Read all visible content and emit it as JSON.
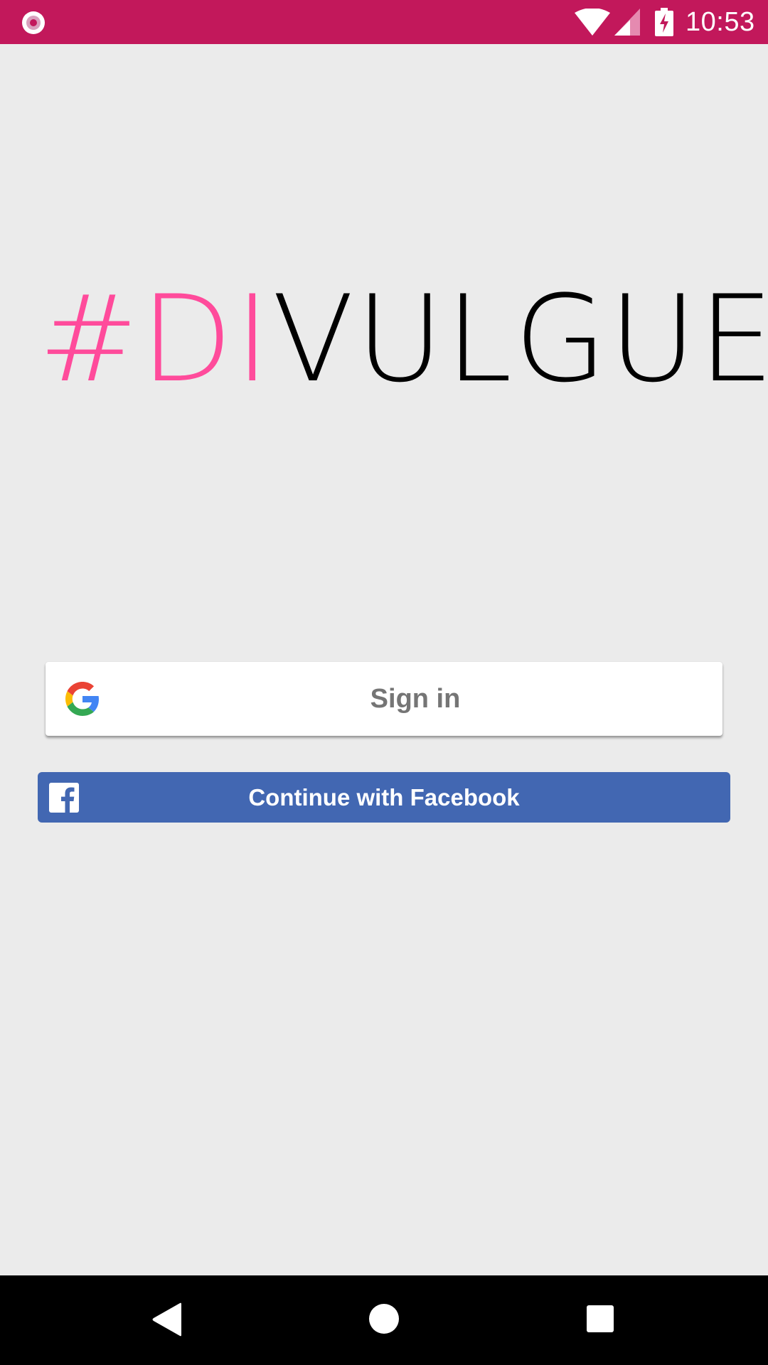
{
  "status_bar": {
    "time": "10:53",
    "background_color": "#c2185b",
    "icons": [
      "app-notification-icon",
      "wifi-icon",
      "cell-signal-icon",
      "battery-charging-icon"
    ]
  },
  "logo": {
    "part_accent": "#DI",
    "part_main": "VULGUE",
    "accent_color": "#ff4b9b",
    "main_color": "#000000"
  },
  "google_signin": {
    "label": "Sign in",
    "icon": "google-g-icon"
  },
  "facebook_login": {
    "label": "Continue with Facebook",
    "icon": "facebook-icon",
    "color": "#4267b2"
  },
  "nav_bar": {
    "buttons": [
      "back-icon",
      "home-icon",
      "recents-icon"
    ]
  }
}
